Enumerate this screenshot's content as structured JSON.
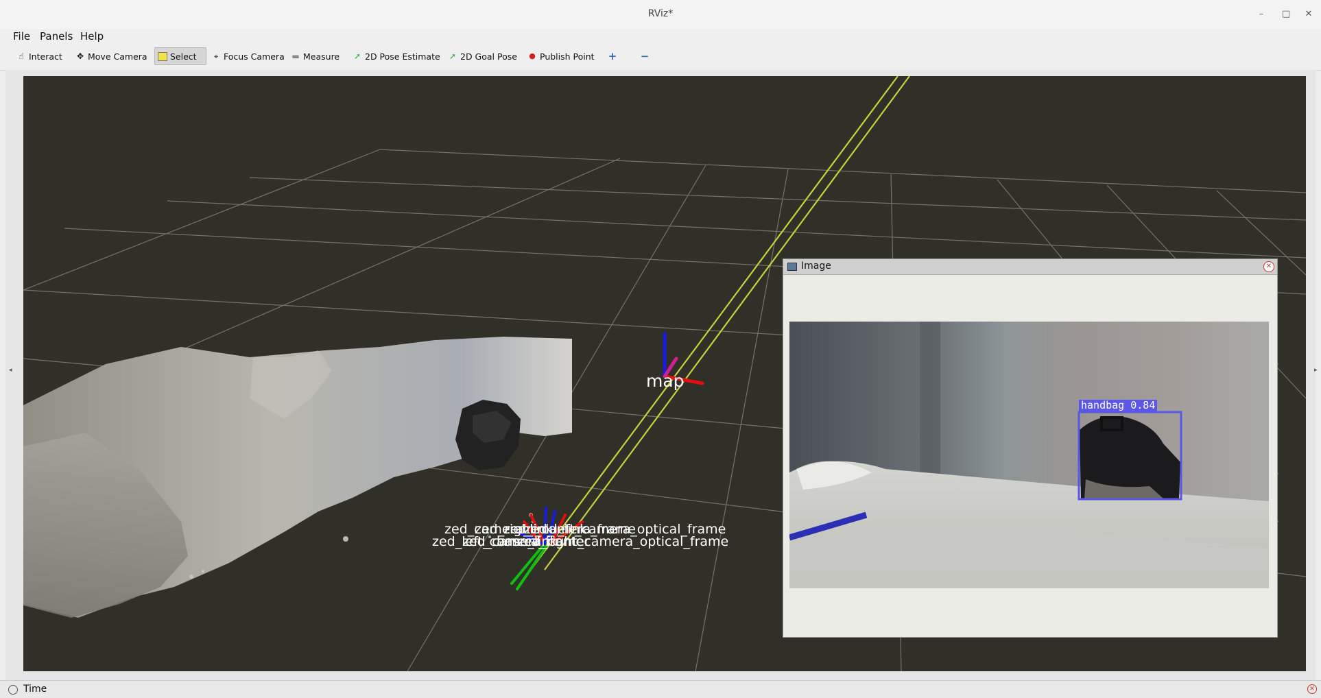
{
  "window": {
    "title": "RViz*",
    "minimize": "–",
    "maximize": "□",
    "close": "✕"
  },
  "menu": [
    {
      "label": "File"
    },
    {
      "label": "Panels"
    },
    {
      "label": "Help"
    }
  ],
  "toolbar": [
    {
      "label": "Interact",
      "icon": "hand-icon",
      "glyph": "☝"
    },
    {
      "label": "Move Camera",
      "icon": "move-icon",
      "glyph": "✥"
    },
    {
      "label": "Select",
      "icon": "select-icon",
      "glyph": "▭",
      "active": true
    },
    {
      "label": "Focus Camera",
      "icon": "focus-icon",
      "glyph": "⌖"
    },
    {
      "label": "Measure",
      "icon": "ruler-icon",
      "glyph": "▬"
    },
    {
      "label": "2D Pose Estimate",
      "icon": "pose-arrow-icon",
      "glyph": "➚"
    },
    {
      "label": "2D Goal Pose",
      "icon": "goal-arrow-icon",
      "glyph": "➚"
    },
    {
      "label": "Publish Point",
      "icon": "map-pin-icon",
      "glyph": "●"
    },
    {
      "label": "",
      "icon": "add-tool-icon",
      "glyph": "+"
    },
    {
      "label": "",
      "icon": "remove-tool-icon",
      "glyph": "−"
    }
  ],
  "viewport": {
    "frames": {
      "map_label": "map",
      "labels_row1": [
        "zed_camera_link",
        "zed_right_camera_frame",
        "zed_imu_link",
        "zed_left_camera_optical_frame"
      ],
      "labels_row2": [
        "zed_left_camera_frame",
        "zed_camera_center",
        "base_link",
        "zed_right_camera_optical_frame"
      ]
    },
    "colors": {
      "background": "#303028",
      "grid": "#8a8a86",
      "laser": "#c8d23c",
      "axis_x": "#e01010",
      "axis_y": "#10c010",
      "axis_z": "#1010e0"
    }
  },
  "image_panel": {
    "title": "Image",
    "detection": {
      "label": "handbag",
      "confidence": "0.84",
      "box_color": "#5a56e6"
    }
  },
  "status": {
    "time_label": "Time"
  }
}
